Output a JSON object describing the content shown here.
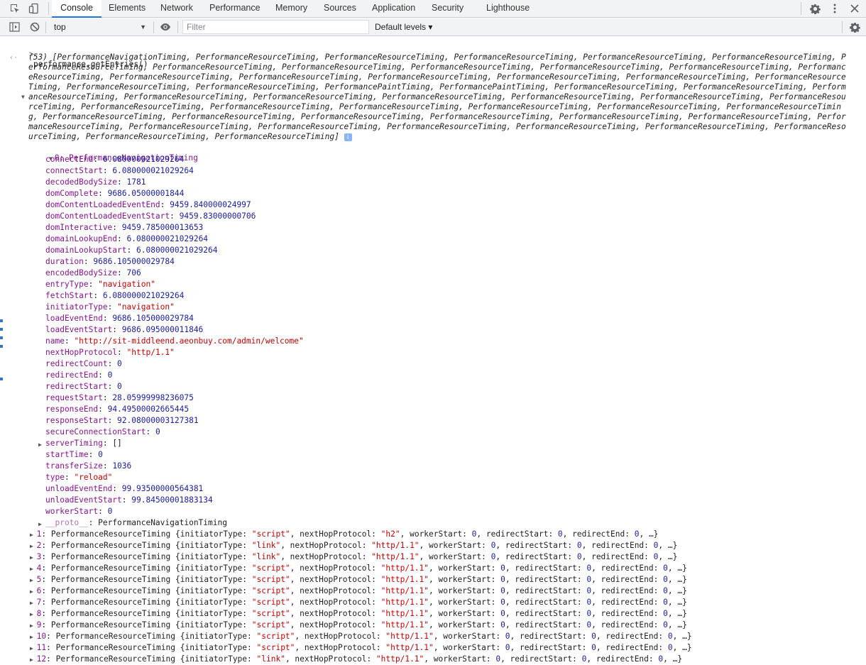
{
  "tabs": [
    {
      "label": "Console",
      "active": true
    },
    {
      "label": "Elements"
    },
    {
      "label": "Network"
    },
    {
      "label": "Performance"
    },
    {
      "label": "Memory"
    },
    {
      "label": "Sources"
    },
    {
      "label": "Application"
    },
    {
      "label": "Security"
    },
    {
      "label": "Lighthouse"
    }
  ],
  "toolbar": {
    "context": "top",
    "filter_placeholder": "Filter",
    "levels": "Default levels ▾"
  },
  "console": {
    "prompt": ">",
    "command": "performance.getEntries()",
    "summary_text": "(53) [PerformanceNavigationTiming, PerformanceResourceTiming, PerformanceResourceTiming, PerformanceResourceTiming, PerformanceResourceTiming, PerformanceResourceTiming, PerformanceResourceTiming, PerformanceResourceTiming, PerformanceResourceTiming, PerformanceResourceTiming, PerformanceResourceTiming, PerformanceResourceTiming, PerformanceResourceTiming, PerformanceResourceTiming, PerformanceResourceTiming, PerformanceResourceTiming, PerformanceResourceTiming, PerformanceResourceTiming, PerformanceResourceTiming, PerformanceResourceTiming, PerformanceResourceTiming, PerformancePaintTiming, PerformancePaintTiming, PerformanceResourceTiming, PerformanceResourceTiming, PerformanceResourceTiming, PerformanceResourceTiming, PerformanceResourceTiming, PerformanceResourceTiming, PerformanceResourceTiming, PerformanceResourceTiming, PerformanceResourceTiming, PerformanceResourceTiming, PerformanceResourceTiming, PerformanceResourceTiming, PerformanceResourceTiming, PerformanceResourceTiming, PerformanceResourceTiming, PerformanceResourceTiming, PerformanceResourceTiming, PerformanceResourceTiming, PerformanceResourceTiming, PerformanceResourceTiming, PerformanceResourceTiming, PerformanceResourceTiming, PerformanceResourceTiming, PerformanceResourceTiming, PerformanceResourceTiming, PerformanceResourceTiming, PerformanceResourceTiming, PerformanceResourceTiming, PerformanceResourceTiming, PerformanceResourceTiming]",
    "entry0_header": "0: PerformanceNavigationTiming",
    "entry0_props": [
      {
        "key": "connectEnd",
        "value": "6.080000021029264",
        "type": "num"
      },
      {
        "key": "connectStart",
        "value": "6.080000021029264",
        "type": "num"
      },
      {
        "key": "decodedBodySize",
        "value": "1781",
        "type": "num"
      },
      {
        "key": "domComplete",
        "value": "9686.05000001844",
        "type": "num"
      },
      {
        "key": "domContentLoadedEventEnd",
        "value": "9459.840000024997",
        "type": "num"
      },
      {
        "key": "domContentLoadedEventStart",
        "value": "9459.83000000706",
        "type": "num"
      },
      {
        "key": "domInteractive",
        "value": "9459.785000013653",
        "type": "num"
      },
      {
        "key": "domainLookupEnd",
        "value": "6.080000021029264",
        "type": "num"
      },
      {
        "key": "domainLookupStart",
        "value": "6.080000021029264",
        "type": "num"
      },
      {
        "key": "duration",
        "value": "9686.105000029784",
        "type": "num"
      },
      {
        "key": "encodedBodySize",
        "value": "706",
        "type": "num"
      },
      {
        "key": "entryType",
        "value": "\"navigation\"",
        "type": "str"
      },
      {
        "key": "fetchStart",
        "value": "6.080000021029264",
        "type": "num"
      },
      {
        "key": "initiatorType",
        "value": "\"navigation\"",
        "type": "str"
      },
      {
        "key": "loadEventEnd",
        "value": "9686.105000029784",
        "type": "num"
      },
      {
        "key": "loadEventStart",
        "value": "9686.095000011846",
        "type": "num"
      },
      {
        "key": "name",
        "value": "\"http://sit-middleend.aeonbuy.com/admin/welcome\"",
        "type": "str"
      },
      {
        "key": "nextHopProtocol",
        "value": "\"http/1.1\"",
        "type": "str"
      },
      {
        "key": "redirectCount",
        "value": "0",
        "type": "num"
      },
      {
        "key": "redirectEnd",
        "value": "0",
        "type": "num"
      },
      {
        "key": "redirectStart",
        "value": "0",
        "type": "num"
      },
      {
        "key": "requestStart",
        "value": "28.05999998236075",
        "type": "num"
      },
      {
        "key": "responseEnd",
        "value": "94.49500002665445",
        "type": "num"
      },
      {
        "key": "responseStart",
        "value": "92.08000003127381",
        "type": "num"
      },
      {
        "key": "secureConnectionStart",
        "value": "0",
        "type": "num"
      },
      {
        "key": "serverTiming",
        "value": "[]",
        "type": "plain",
        "expandable": true
      },
      {
        "key": "startTime",
        "value": "0",
        "type": "num"
      },
      {
        "key": "transferSize",
        "value": "1036",
        "type": "num"
      },
      {
        "key": "type",
        "value": "\"reload\"",
        "type": "str"
      },
      {
        "key": "unloadEventEnd",
        "value": "99.93500000564381",
        "type": "num"
      },
      {
        "key": "unloadEventStart",
        "value": "99.84500001883134",
        "type": "num"
      },
      {
        "key": "workerStart",
        "value": "0",
        "type": "num"
      },
      {
        "key": "__proto__",
        "value": "PerformanceNavigationTiming",
        "type": "plain",
        "expandable": true,
        "dim": true
      }
    ],
    "entries": [
      {
        "index": "1",
        "initiator": "\"script\"",
        "protocol": "\"h2\""
      },
      {
        "index": "2",
        "initiator": "\"link\"",
        "protocol": "\"http/1.1\""
      },
      {
        "index": "3",
        "initiator": "\"link\"",
        "protocol": "\"http/1.1\""
      },
      {
        "index": "4",
        "initiator": "\"script\"",
        "protocol": "\"http/1.1\""
      },
      {
        "index": "5",
        "initiator": "\"script\"",
        "protocol": "\"http/1.1\""
      },
      {
        "index": "6",
        "initiator": "\"script\"",
        "protocol": "\"http/1.1\""
      },
      {
        "index": "7",
        "initiator": "\"script\"",
        "protocol": "\"http/1.1\""
      },
      {
        "index": "8",
        "initiator": "\"script\"",
        "protocol": "\"http/1.1\""
      },
      {
        "index": "9",
        "initiator": "\"script\"",
        "protocol": "\"http/1.1\""
      },
      {
        "index": "10",
        "initiator": "\"script\"",
        "protocol": "\"http/1.1\""
      },
      {
        "index": "11",
        "initiator": "\"script\"",
        "protocol": "\"http/1.1\""
      },
      {
        "index": "12",
        "initiator": "\"link\"",
        "protocol": "\"http/1.1\""
      }
    ],
    "entry_type_label": "PerformanceResourceTiming",
    "entry_tail": "workerStart: 0, redirectStart: 0, redirectEnd: 0, …}"
  }
}
